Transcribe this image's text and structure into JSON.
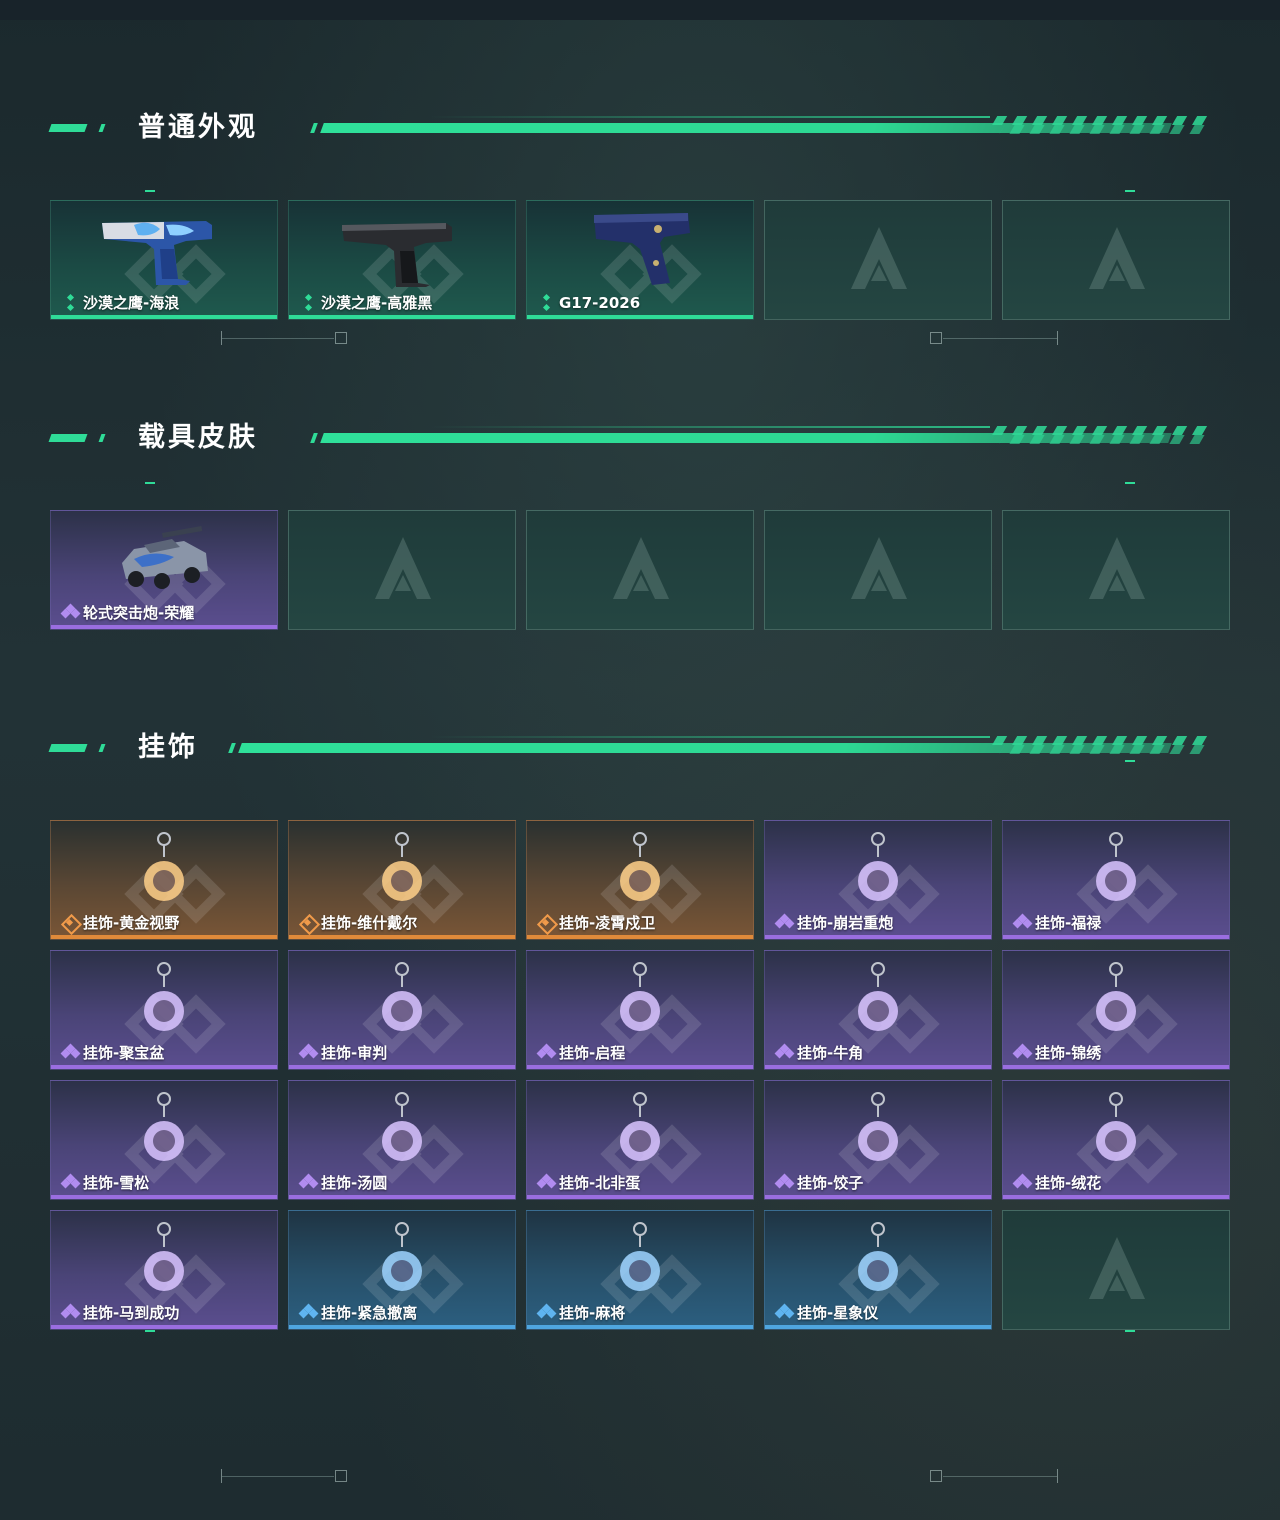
{
  "sections": [
    {
      "title": "普通外观",
      "items": [
        {
          "label": "沙漠之鹰-海浪",
          "rarity": "green",
          "icon": "pistol-blue-white-icon"
        },
        {
          "label": "沙漠之鹰-高雅黑",
          "rarity": "green",
          "icon": "pistol-black-icon"
        },
        {
          "label": "G17-2026",
          "rarity": "green",
          "icon": "pistol-navy-icon"
        },
        {
          "label": "",
          "rarity": "empty"
        },
        {
          "label": "",
          "rarity": "empty"
        }
      ]
    },
    {
      "title": "载具皮肤",
      "items": [
        {
          "label": "轮式突击炮-荣耀",
          "rarity": "purple",
          "icon": "armored-vehicle-icon"
        },
        {
          "label": "",
          "rarity": "empty"
        },
        {
          "label": "",
          "rarity": "empty"
        },
        {
          "label": "",
          "rarity": "empty"
        },
        {
          "label": "",
          "rarity": "empty"
        }
      ]
    },
    {
      "title": "挂饰",
      "items": [
        {
          "label": "挂饰-黄金视野",
          "rarity": "orange",
          "icon": "charm-figure-icon"
        },
        {
          "label": "挂饰-维什戴尔",
          "rarity": "orange",
          "icon": "charm-card-icon"
        },
        {
          "label": "挂饰-凌霄戍卫",
          "rarity": "orange",
          "icon": "charm-bird-icon"
        },
        {
          "label": "挂饰-崩岩重炮",
          "rarity": "purple",
          "icon": "charm-rock-figure-icon"
        },
        {
          "label": "挂饰-福禄",
          "rarity": "purple",
          "icon": "charm-gourd-icon"
        },
        {
          "label": "挂饰-聚宝盆",
          "rarity": "purple",
          "icon": "charm-treasure-bowl-icon"
        },
        {
          "label": "挂饰-审判",
          "rarity": "purple",
          "icon": "charm-judgement-card-icon"
        },
        {
          "label": "挂饰-启程",
          "rarity": "purple",
          "icon": "charm-ring-emblem-icon"
        },
        {
          "label": "挂饰-牛角",
          "rarity": "purple",
          "icon": "charm-horns-icon"
        },
        {
          "label": "挂饰-锦绣",
          "rarity": "purple",
          "icon": "charm-butterfly-icon"
        },
        {
          "label": "挂饰-雪松",
          "rarity": "purple",
          "icon": "charm-snow-pine-icon"
        },
        {
          "label": "挂饰-汤圆",
          "rarity": "purple",
          "icon": "charm-tangyuan-bowl-icon"
        },
        {
          "label": "挂饰-北非蛋",
          "rarity": "purple",
          "icon": "charm-egg-pan-icon"
        },
        {
          "label": "挂饰-饺子",
          "rarity": "purple",
          "icon": "charm-dumpling-plate-icon"
        },
        {
          "label": "挂饰-绒花",
          "rarity": "purple",
          "icon": "charm-red-flower-icon"
        },
        {
          "label": "挂饰-马到成功",
          "rarity": "purple",
          "icon": "charm-red-horse-icon"
        },
        {
          "label": "挂饰-紧急撤离",
          "rarity": "blue",
          "icon": "charm-green-tag-icon"
        },
        {
          "label": "挂饰-麻将",
          "rarity": "blue",
          "icon": "charm-mahjong-tile-icon"
        },
        {
          "label": "挂饰-星象仪",
          "rarity": "blue",
          "icon": "charm-astrolabe-icon"
        },
        {
          "label": "",
          "rarity": "empty"
        }
      ]
    }
  ],
  "colors": {
    "accent_green": "#2fdc98",
    "rarity_green": "#2fdc98",
    "rarity_purple": "#9a6ee0",
    "rarity_orange": "#e08a3a",
    "rarity_blue": "#4fa6e0"
  }
}
